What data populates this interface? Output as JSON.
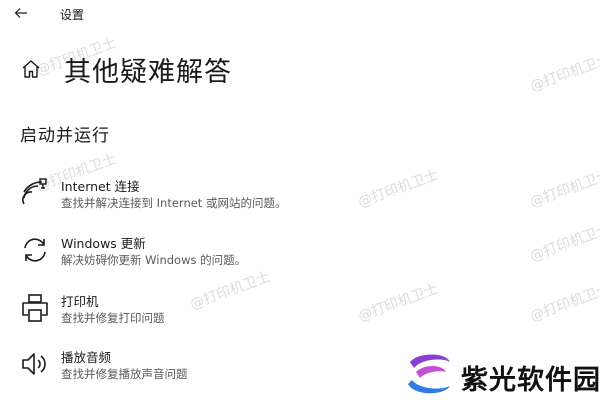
{
  "titlebar": {
    "title": "设置"
  },
  "header": {
    "title": "其他疑难解答"
  },
  "section": {
    "title": "启动并运行"
  },
  "items": [
    {
      "name": "Internet 连接",
      "desc": "查找并解决连接到 Internet 或网站的问题。",
      "icon": "wifi-icon"
    },
    {
      "name": "Windows 更新",
      "desc": "解决妨碍你更新 Windows 的问题。",
      "icon": "refresh-icon"
    },
    {
      "name": "打印机",
      "desc": "查找并修复打印问题",
      "icon": "printer-icon"
    },
    {
      "name": "播放音频",
      "desc": "查找并修复播放声音问题",
      "icon": "speaker-icon"
    }
  ],
  "watermark": {
    "text": "@打印机卫士"
  },
  "logo": {
    "text": "紫光软件园"
  },
  "colors": {
    "background": "#ffffff",
    "text": "#1a1a1a",
    "secondary_text": "#5a5a5a",
    "logo_purple": "#8a3fd1",
    "logo_blue": "#2f7de1"
  }
}
